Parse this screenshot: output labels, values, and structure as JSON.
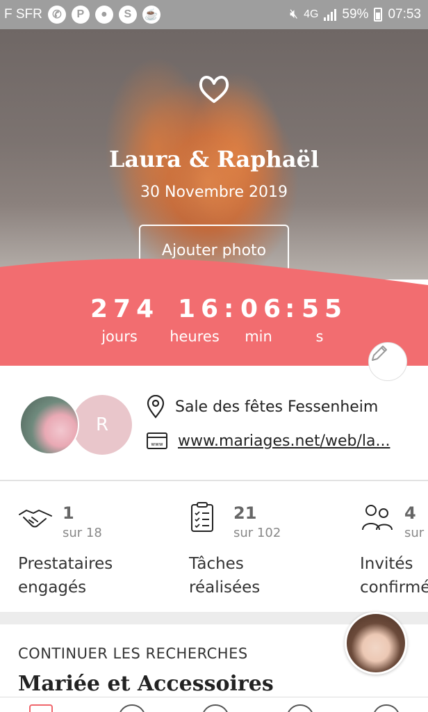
{
  "status_bar": {
    "carrier": "F SFR",
    "battery": "59%",
    "time": "07:53",
    "network": "4G",
    "icons": [
      "whatsapp-icon",
      "pinterest-icon",
      "cookie-icon",
      "skype-icon",
      "coffee-icon",
      "mute-icon",
      "signal-icon",
      "battery-icon"
    ]
  },
  "hero": {
    "couple": "Laura & Raphaël",
    "date": "30 Novembre 2019",
    "add_photo": "Ajouter photo"
  },
  "countdown": {
    "days": "274",
    "hours": "16",
    "minutes": "06",
    "seconds": "55",
    "sep": ":",
    "labels": {
      "days": "jours",
      "hours": "heures",
      "minutes": "min",
      "seconds": "s"
    },
    "color": "#f26d70"
  },
  "info": {
    "avatar_initial": "R",
    "venue": "Sale des fêtes Fessenheim",
    "website": "www.mariages.net/web/la..."
  },
  "stats": [
    {
      "num": "1",
      "sub": "sur 18",
      "label_line1": "Prestataires",
      "label_line2": "engagés"
    },
    {
      "num": "21",
      "sub": "sur 102",
      "label_line1": "Tâches",
      "label_line2": "réalisées"
    },
    {
      "num": "4",
      "sub": "sur",
      "label_line1": "Invités",
      "label_line2": "confirmé"
    }
  ],
  "continue": {
    "title": "CONTINUER LES RECHERCHES",
    "category": "Mariée et Accessoires"
  },
  "colors": {
    "accent": "#f26d70"
  }
}
